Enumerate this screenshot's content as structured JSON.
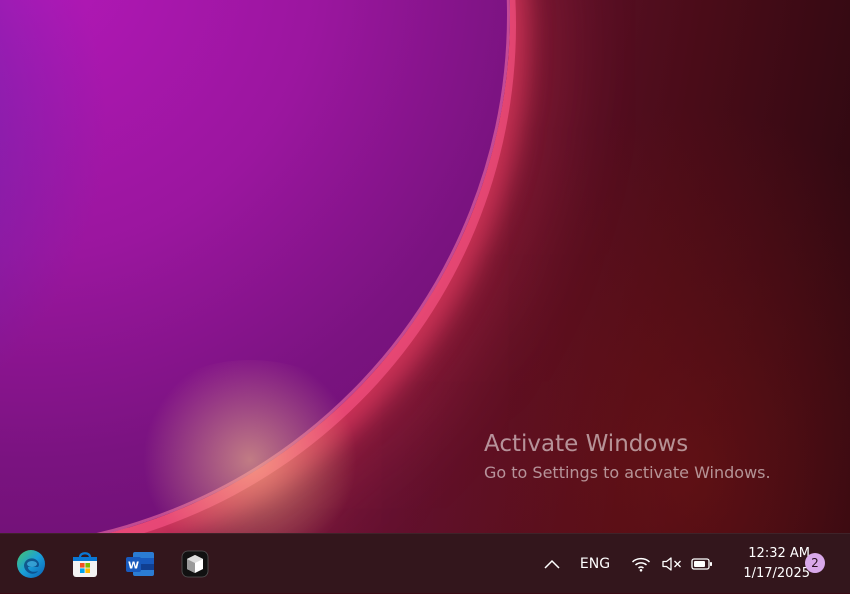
{
  "watermark": {
    "title": "Activate Windows",
    "subtitle": "Go to Settings to activate Windows."
  },
  "taskbar": {
    "apps": [
      {
        "name": "Microsoft Edge",
        "icon": "edge-icon"
      },
      {
        "name": "Microsoft Store",
        "icon": "store-icon"
      },
      {
        "name": "Microsoft Word",
        "icon": "word-icon"
      },
      {
        "name": "App",
        "icon": "cube-app-icon"
      }
    ],
    "tray": {
      "overflow_icon": "chevron-up-icon",
      "language": "ENG",
      "wifi_icon": "wifi-icon",
      "volume_icon": "volume-muted-icon",
      "battery_icon": "battery-icon"
    },
    "clock": {
      "time": "12:32 AM",
      "date": "1/17/2025"
    },
    "notifications": {
      "count": "2"
    }
  },
  "colors": {
    "taskbar_bg": "#33161c",
    "notification_badge": "#d9a8ea",
    "word_blue": "#185abd",
    "edge_blue": "#0c8cd8",
    "edge_green": "#46c56b"
  }
}
